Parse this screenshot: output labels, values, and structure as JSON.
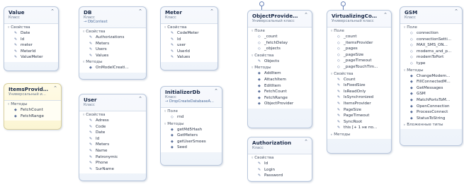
{
  "boxes": {
    "value": {
      "title": "Value",
      "subtitle": "Класс",
      "sections": [
        {
          "label": "Свойства",
          "items": [
            "Date",
            "Id",
            "meter",
            "MeterId",
            "ValueMeter"
          ]
        }
      ]
    },
    "itemsprovider": {
      "title": "ItemsProvider<...",
      "subtitle": "Универсальный интер...",
      "sections": [
        {
          "label": "Методы",
          "items": [
            "FetchCount",
            "FetchRange"
          ]
        }
      ]
    },
    "db": {
      "title": "DB",
      "subtitle": "Класс",
      "base": "→ DbContext",
      "sections": [
        {
          "label": "Свойства",
          "items": [
            "Authorizations",
            "Meters",
            "Users",
            "Values"
          ]
        },
        {
          "label": "Методы",
          "items": [
            "OnModelCreati..."
          ]
        }
      ]
    },
    "user": {
      "title": "User",
      "subtitle": "Класс",
      "sections": [
        {
          "label": "Свойства",
          "items": [
            "Adress",
            "Code",
            "Date",
            "Id",
            "Meters",
            "Name",
            "Patronymic",
            "Phone",
            "SurName"
          ]
        }
      ]
    },
    "meter": {
      "title": "Meter",
      "subtitle": "Класс",
      "sections": [
        {
          "label": "Свойства",
          "items": [
            "CodeMeter",
            "Id",
            "user",
            "UserId",
            "Values"
          ]
        }
      ]
    },
    "initializer": {
      "title": "InitializerDb",
      "subtitle": "Класс",
      "base": "→ DropCreateDatabaseA...",
      "sections": [
        {
          "label": "Поле",
          "items": [
            "rnd"
          ]
        },
        {
          "label": "Методы",
          "items": [
            "getMd5Hash",
            "GetMeters",
            "getUserSmoes",
            "Seed"
          ]
        }
      ]
    },
    "objectprovider": {
      "title": "ObjectProvider...",
      "subtitle": "Универсальный класс",
      "sections": [
        {
          "label": "Поле",
          "items": [
            "_count",
            "_fetchDelay",
            "_objects"
          ]
        },
        {
          "label": "Свойства",
          "items": [
            "Objects"
          ]
        },
        {
          "label": "Методы",
          "items": [
            "AddItem",
            "AttachItem",
            "EditItem",
            "FetchCount",
            "FetchRange",
            "ObjectProvider"
          ]
        }
      ]
    },
    "authorization": {
      "title": "Authorization",
      "subtitle": "Класс",
      "sections": [
        {
          "label": "Свойства",
          "items": [
            "Id",
            "Login",
            "Password"
          ]
        }
      ]
    },
    "virtualizing": {
      "title": "VirtualizingColl...",
      "subtitle": "Универсальный класс",
      "sections": [
        {
          "label": "Поле",
          "items": [
            "_count",
            "_itemsProvider",
            "_pages",
            "_pageSize",
            "_pageTimeout",
            "_pageTouchTim..."
          ]
        },
        {
          "label": "Свойства",
          "items": [
            "Count",
            "IsFixedSize",
            "IsReadOnly",
            "IsSynchronized",
            "ItemsProvider",
            "PageSize",
            "PageTimeout",
            "SyncRoot",
            "this [+ 1 не по..."
          ]
        },
        {
          "label": "Методы",
          "items": []
        }
      ]
    },
    "gsm": {
      "title": "GSM",
      "subtitle": "Класс",
      "sections": [
        {
          "label": "Поле",
          "items": [
            "connection",
            "connectionSetti...",
            "MAX_SMS_ON...",
            "modems_and_p...",
            "modemToPort",
            "type"
          ]
        },
        {
          "label": "Методы",
          "items": [
            "ChangeModem...",
            "FillConnectedM...",
            "GetMessages",
            "GSM",
            "MatchPortsToM...",
            "OpenConnection",
            "ProcessConnect",
            "StatusToString"
          ]
        },
        {
          "label": "Вложенные типы",
          "items": []
        }
      ]
    }
  }
}
